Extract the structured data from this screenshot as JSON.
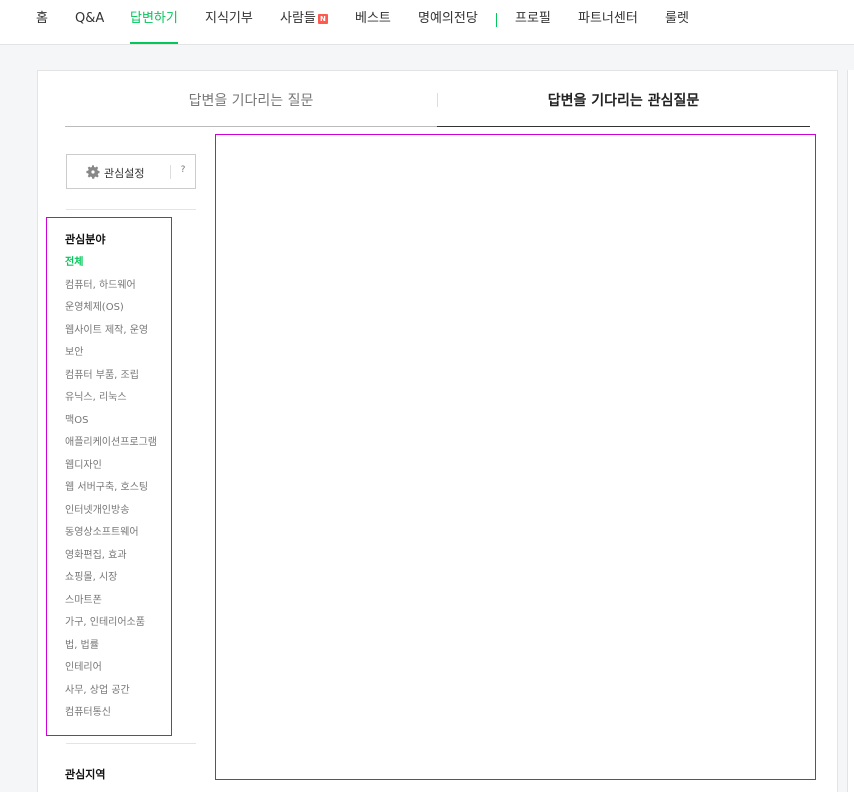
{
  "nav": {
    "items": [
      {
        "label": "홈"
      },
      {
        "label": "Q&A"
      },
      {
        "label": "답변하기"
      },
      {
        "label": "지식기부"
      },
      {
        "label": "사람들",
        "badge": "N"
      },
      {
        "label": "베스트"
      },
      {
        "label": "명예의전당"
      },
      {
        "label": "프로필"
      },
      {
        "label": "파트너센터"
      },
      {
        "label": "룰렛"
      }
    ],
    "active": "답변하기",
    "accent_color": "#03c75a"
  },
  "tabs": {
    "tab1": "답변을 기다리는 질문",
    "tab2": "답변을 기다리는 관심질문",
    "active": "답변을 기다리는 관심질문"
  },
  "settings": {
    "label": "관심설정",
    "help": "?",
    "icon": "gear-icon"
  },
  "interest_fields": {
    "title": "관심분야",
    "items": [
      "전체",
      "컴퓨터, 하드웨어",
      "운영체제(OS)",
      "웹사이트 제작, 운영",
      "보안",
      "컴퓨터 부품, 조립",
      "유닉스, 리눅스",
      "맥OS",
      "애플리케이션프로그램",
      "웹디자인",
      "웹 서버구축, 호스팅",
      "인터넷개인방송",
      "동영상소프트웨어",
      "영화편집, 효과",
      "쇼핑몰, 시장",
      "스마트폰",
      "가구, 인테리어소품",
      "법, 법률",
      "인테리어",
      "사무, 상업 공간",
      "컴퓨터통신"
    ],
    "active": "전체"
  },
  "interest_regions": {
    "title": "관심지역"
  }
}
